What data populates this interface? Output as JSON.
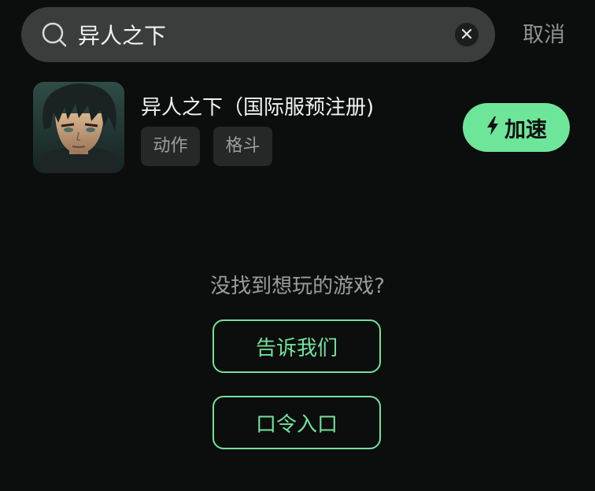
{
  "search": {
    "value": "异人之下",
    "cancel_label": "取消",
    "icons": {
      "search": "search-icon",
      "clear": "close-icon"
    }
  },
  "results": [
    {
      "title": "异人之下（国际服预注册)",
      "tags": [
        "动作",
        "格斗"
      ],
      "action_label": "加速",
      "action_icon": "lightning-icon"
    }
  ],
  "empty_prompt": {
    "text": "没找到想玩的游戏?",
    "feedback_label": "告诉我们",
    "code_label": "口令入口"
  },
  "colors": {
    "background": "#0c0d0d",
    "accent": "#6ee69a",
    "search_bg": "#3b3d3d"
  }
}
